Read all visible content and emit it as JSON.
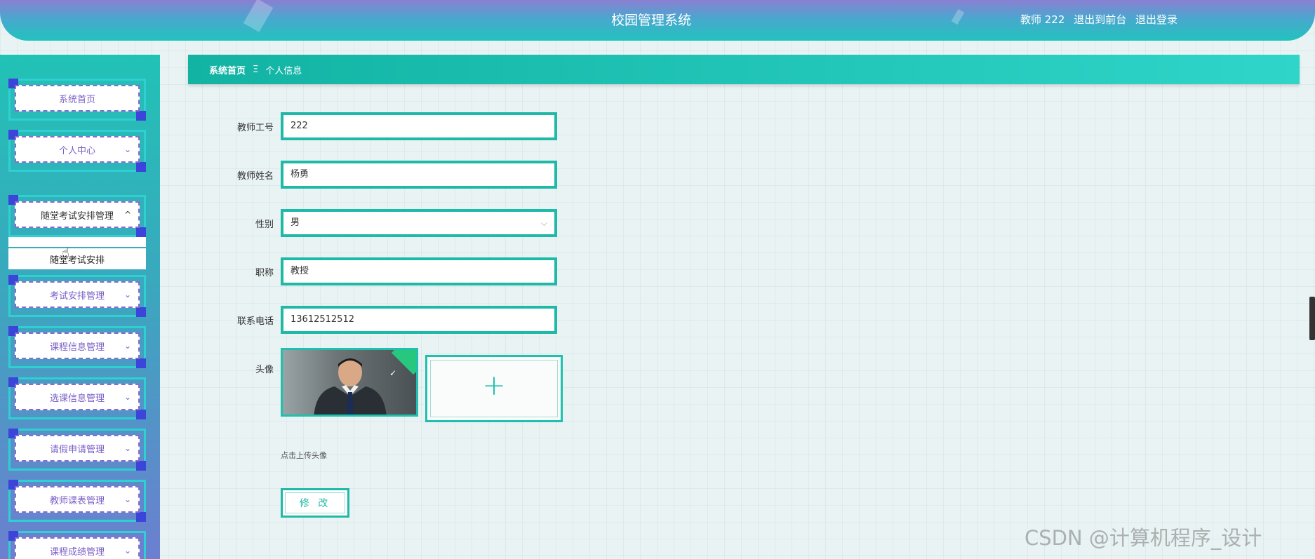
{
  "header": {
    "title": "校园管理系统",
    "user_label": "教师 222",
    "front_link": "退出到前台",
    "logout_link": "退出登录"
  },
  "sidebar": {
    "items": [
      {
        "label": "系统首页"
      },
      {
        "label": "个人中心",
        "chevron": "⌄"
      },
      {
        "label": "随堂考试安排管理",
        "chevron": "^"
      },
      {
        "label": "考试安排管理",
        "chevron": "⌄"
      },
      {
        "label": "课程信息管理",
        "chevron": "⌄"
      },
      {
        "label": "选课信息管理",
        "chevron": "⌄"
      },
      {
        "label": "请假申请管理",
        "chevron": "⌄"
      },
      {
        "label": "教师课表管理",
        "chevron": "⌄"
      },
      {
        "label": "课程成绩管理",
        "chevron": "⌄"
      }
    ],
    "sub_item": "随堂考试安排"
  },
  "breadcrumb": {
    "home": "系统首页",
    "separator": "Ξ",
    "current": "个人信息"
  },
  "form": {
    "teacher_id_label": "教师工号",
    "teacher_id_value": "222",
    "teacher_name_label": "教师姓名",
    "teacher_name_value": "杨勇",
    "gender_label": "性别",
    "gender_value": "男",
    "title_label": "职称",
    "title_value": "教授",
    "phone_label": "联系电话",
    "phone_value": "13612512512",
    "avatar_label": "头像",
    "upload_hint": "点击上传头像",
    "submit_label": "修 改"
  },
  "watermark": "CSDN @计算机程序_设计",
  "colors": {
    "accent": "#1fb9a8",
    "menu_text": "#7a5fc6",
    "corner": "#3b45d9"
  }
}
